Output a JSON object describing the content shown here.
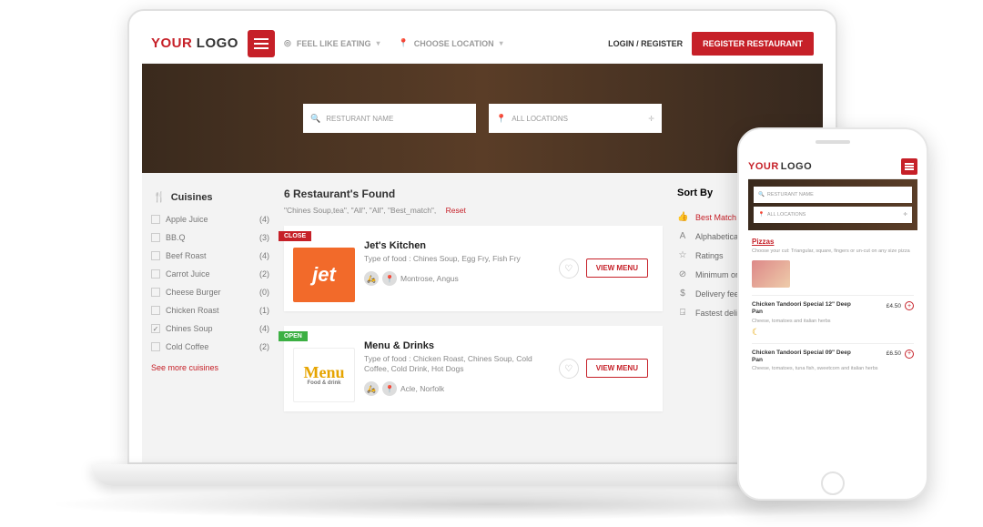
{
  "brand": {
    "your": "YOUR",
    "logo": "LOGO"
  },
  "topnav": {
    "feel": "FEEL LIKE EATING",
    "location": "CHOOSE LOCATION",
    "login": "LOGIN / REGISTER",
    "register": "REGISTER RESTAURANT"
  },
  "hero": {
    "name_placeholder": "RESTURANT NAME",
    "loc_placeholder": "ALL LOCATIONS"
  },
  "sidebar": {
    "title": "Cuisines",
    "items": [
      {
        "label": "Apple Juice",
        "count": "(4)",
        "checked": false
      },
      {
        "label": "BB.Q",
        "count": "(3)",
        "checked": false
      },
      {
        "label": "Beef Roast",
        "count": "(4)",
        "checked": false
      },
      {
        "label": "Carrot Juice",
        "count": "(2)",
        "checked": false
      },
      {
        "label": "Cheese Burger",
        "count": "(0)",
        "checked": false
      },
      {
        "label": "Chicken Roast",
        "count": "(1)",
        "checked": false
      },
      {
        "label": "Chines Soup",
        "count": "(4)",
        "checked": true
      },
      {
        "label": "Cold Coffee",
        "count": "(2)",
        "checked": false
      }
    ],
    "seemore": "See more cuisines"
  },
  "results": {
    "heading": "6 Restaurant's Found",
    "filters": "\"Chines Soup,tea\", \"All\", \"All\", \"Best_match\",",
    "reset": "Reset",
    "cards": [
      {
        "status": "CLOSE",
        "name": "Jet's Kitchen",
        "type": "Type of food : Chines Soup, Egg Fry, Fish Fry",
        "location": "Montrose, Angus",
        "view": "VIEW MENU",
        "logo_text": "jet",
        "logo_bg": "#f26a2a"
      },
      {
        "status": "OPEN",
        "name": "Menu & Drinks",
        "type": "Type of food : Chicken Roast, Chines Soup, Cold Coffee, Cold Drink, Hot Dogs",
        "location": "Acle, Norfolk",
        "view": "VIEW MENU",
        "logo_text": "Menu",
        "logo_sub": "Food & drink",
        "logo_bg": "#ffffff"
      }
    ]
  },
  "sort": {
    "title": "Sort By",
    "items": [
      {
        "icon": "👍",
        "label": "Best Match",
        "active": true
      },
      {
        "icon": "A",
        "label": "Alphabetical"
      },
      {
        "icon": "☆",
        "label": "Ratings"
      },
      {
        "icon": "⊘",
        "label": "Minimum order value"
      },
      {
        "icon": "$",
        "label": "Delivery fee"
      },
      {
        "icon": "⍈",
        "label": "Fastest delivery"
      }
    ]
  },
  "phone": {
    "search_name": "RESTURANT NAME",
    "search_loc": "ALL LOCATIONS",
    "category": "Pizzas",
    "cat_desc": "Choose your cut: Triangular, square, fingers or un-cut on any size pizza",
    "items": [
      {
        "name": "Chicken Tandoori Special 12\" Deep Pan",
        "price": "£4.50",
        "desc": ""
      },
      {
        "name": "Chicken Tandoori Special 09\" Deep Pan",
        "price": "£6.50",
        "desc": "Cheese, tomatoes, tuna fish, sweetcorn and italian herbs"
      }
    ],
    "item0_desc": "Cheese, tomatoes and italian herbs"
  }
}
